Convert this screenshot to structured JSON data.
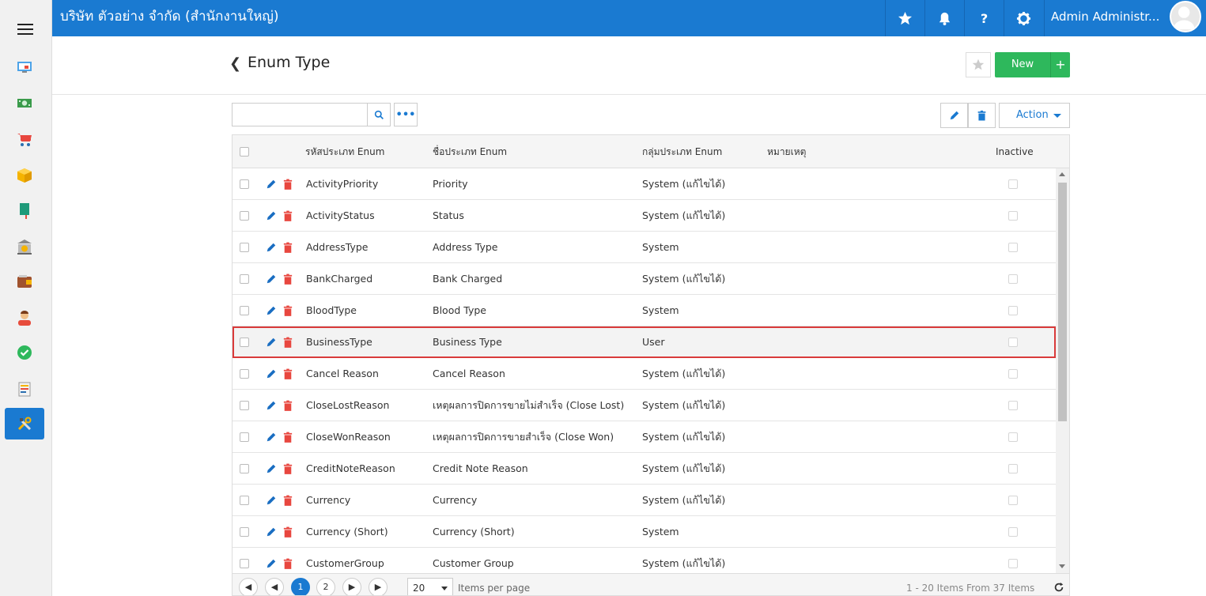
{
  "topbar": {
    "company": "บริษัท ตัวอย่าง จำกัด (สำนักงานใหญ่)",
    "user": "Admin Administr...",
    "icons": [
      "star-icon",
      "bell-icon",
      "help-icon",
      "gear-icon"
    ],
    "brand_color": "#1a7ad1"
  },
  "sidebar": {
    "items": [
      "dashboard-icon",
      "money-icon",
      "cart-icon",
      "box-icon",
      "book-icon",
      "bank-icon",
      "wallet-icon",
      "person-icon",
      "check-icon",
      "transfer-icon",
      "tools-icon"
    ],
    "active_item": "tools-icon"
  },
  "header": {
    "title": "Enum Type",
    "new_label": "New",
    "plus_label": "+"
  },
  "toolbar": {
    "search_placeholder": "",
    "more_label": "•••",
    "action_label": "Action"
  },
  "grid": {
    "columns": {
      "code": "รหัสประเภท Enum",
      "name": "ชื่อประเภท Enum",
      "group": "กลุ่มประเภท Enum",
      "remark": "หมายเหตุ",
      "inactive": "Inactive"
    },
    "rows": [
      {
        "code": "ActivityPriority",
        "name": "Priority",
        "group": "System (แก้ไขได้)",
        "remark": ""
      },
      {
        "code": "ActivityStatus",
        "name": "Status",
        "group": "System (แก้ไขได้)",
        "remark": ""
      },
      {
        "code": "AddressType",
        "name": "Address Type",
        "group": "System",
        "remark": ""
      },
      {
        "code": "BankCharged",
        "name": "Bank Charged",
        "group": "System (แก้ไขได้)",
        "remark": ""
      },
      {
        "code": "BloodType",
        "name": "Blood Type",
        "group": "System",
        "remark": ""
      },
      {
        "code": "BusinessType",
        "name": "Business Type",
        "group": "User",
        "remark": "",
        "highlighted": true
      },
      {
        "code": "Cancel Reason",
        "name": "Cancel Reason",
        "group": "System (แก้ไขได้)",
        "remark": ""
      },
      {
        "code": "CloseLostReason",
        "name": "เหตุผลการปิดการขายไม่สำเร็จ (Close Lost)",
        "group": "System (แก้ไขได้)",
        "remark": ""
      },
      {
        "code": "CloseWonReason",
        "name": "เหตุผลการปิดการขายสำเร็จ (Close Won)",
        "group": "System (แก้ไขได้)",
        "remark": ""
      },
      {
        "code": "CreditNoteReason",
        "name": "Credit Note Reason",
        "group": "System (แก้ไขได้)",
        "remark": ""
      },
      {
        "code": "Currency",
        "name": "Currency",
        "group": "System (แก้ไขได้)",
        "remark": ""
      },
      {
        "code": "Currency (Short)",
        "name": "Currency (Short)",
        "group": "System",
        "remark": ""
      },
      {
        "code": "CustomerGroup",
        "name": "Customer Group",
        "group": "System (แก้ไขได้)",
        "remark": ""
      }
    ]
  },
  "pager": {
    "pages": [
      "1",
      "2"
    ],
    "current_page": "1",
    "page_size": "20",
    "per_page_label": "Items per page",
    "info": "1 - 20 Items From 37 Items"
  }
}
